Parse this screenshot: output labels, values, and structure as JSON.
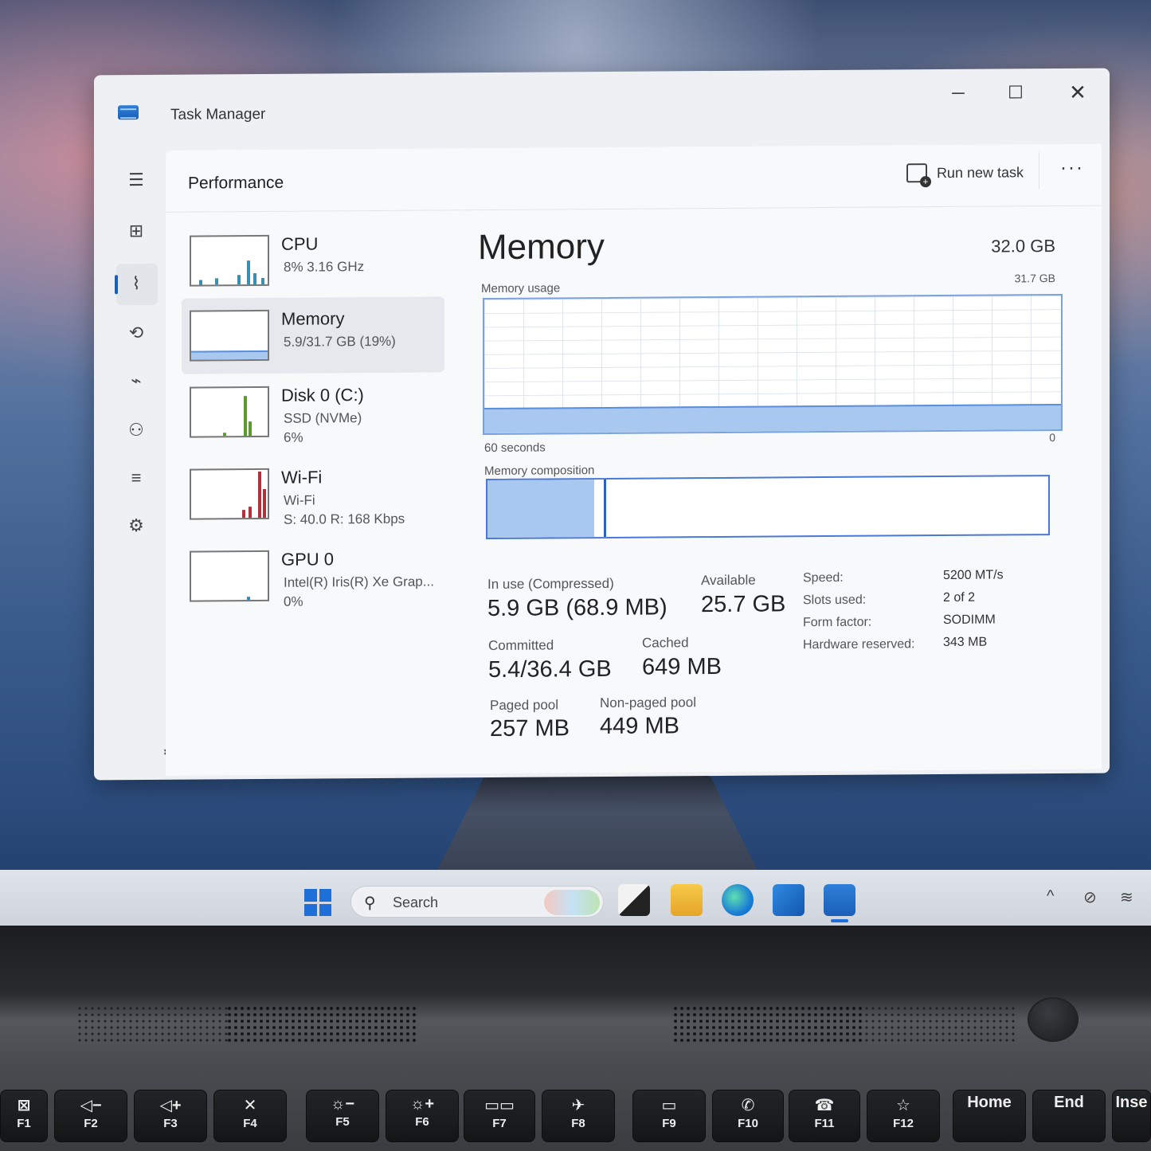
{
  "window": {
    "title": "Task Manager",
    "controls": {
      "minimize": "─",
      "maximize": "☐",
      "close": "✕"
    }
  },
  "header": {
    "page_title": "Performance",
    "run_new_task": "Run new task",
    "more": "···"
  },
  "nav": {
    "items": [
      {
        "name": "menu",
        "glyph": "☰"
      },
      {
        "name": "processes",
        "glyph": "⊞"
      },
      {
        "name": "performance",
        "glyph": "⌇"
      },
      {
        "name": "app-history",
        "glyph": "⟲"
      },
      {
        "name": "startup-apps",
        "glyph": "⌁"
      },
      {
        "name": "users",
        "glyph": "⚇"
      },
      {
        "name": "details",
        "glyph": "≡"
      },
      {
        "name": "services",
        "glyph": "⚙"
      }
    ],
    "settings_glyph": "⚙"
  },
  "devices": [
    {
      "name": "CPU",
      "sub1": "8%  3.16 GHz",
      "sub2": ""
    },
    {
      "name": "Memory",
      "sub1": "5.9/31.7 GB (19%)",
      "sub2": ""
    },
    {
      "name": "Disk 0 (C:)",
      "sub1": "SSD (NVMe)",
      "sub2": "6%"
    },
    {
      "name": "Wi-Fi",
      "sub1": "Wi-Fi",
      "sub2": "S: 40.0  R: 168 Kbps"
    },
    {
      "name": "GPU 0",
      "sub1": "Intel(R) Iris(R) Xe Grap...",
      "sub2": "0%"
    }
  ],
  "memory": {
    "title": "Memory",
    "total": "32.0 GB",
    "usage_label": "Memory usage",
    "usage_max": "31.7 GB",
    "graph_time": "60 seconds",
    "graph_min": "0",
    "usage_fraction": 0.19,
    "composition_label": "Memory composition",
    "composition_in_use_fraction": 0.19,
    "stats": {
      "in_use_label": "In use (Compressed)",
      "in_use_value": "5.9 GB (68.9 MB)",
      "available_label": "Available",
      "available_value": "25.7 GB",
      "committed_label": "Committed",
      "committed_value": "5.4/36.4 GB",
      "cached_label": "Cached",
      "cached_value": "649 MB",
      "paged_label": "Paged pool",
      "paged_value": "257 MB",
      "nonpaged_label": "Non-paged pool",
      "nonpaged_value": "449 MB"
    },
    "specs": {
      "speed_key": "Speed:",
      "speed_val": "5200 MT/s",
      "slots_key": "Slots used:",
      "slots_val": "2 of 2",
      "form_key": "Form factor:",
      "form_val": "SODIMM",
      "hw_key": "Hardware reserved:",
      "hw_val": "343 MB"
    }
  },
  "taskbar": {
    "search_placeholder": "Search",
    "search_glyph": "⚲"
  },
  "keyboard": {
    "keys": [
      {
        "sym": "⊠",
        "lbl": "F1"
      },
      {
        "sym": "◁−",
        "lbl": "F2"
      },
      {
        "sym": "◁+",
        "lbl": "F3"
      },
      {
        "sym": "✕",
        "lbl": "F4"
      },
      {
        "sym": "☼−",
        "lbl": "F5"
      },
      {
        "sym": "☼+",
        "lbl": "F6"
      },
      {
        "sym": "▭▭",
        "lbl": "F7"
      },
      {
        "sym": "✈",
        "lbl": "F8"
      },
      {
        "sym": "▭",
        "lbl": "F9"
      },
      {
        "sym": "✆",
        "lbl": "F10"
      },
      {
        "sym": "☎",
        "lbl": "F11"
      },
      {
        "sym": "☆",
        "lbl": "F12"
      },
      {
        "sym": "",
        "lbl": "Home"
      },
      {
        "sym": "",
        "lbl": "End"
      },
      {
        "sym": "",
        "lbl": "Inse"
      }
    ]
  }
}
